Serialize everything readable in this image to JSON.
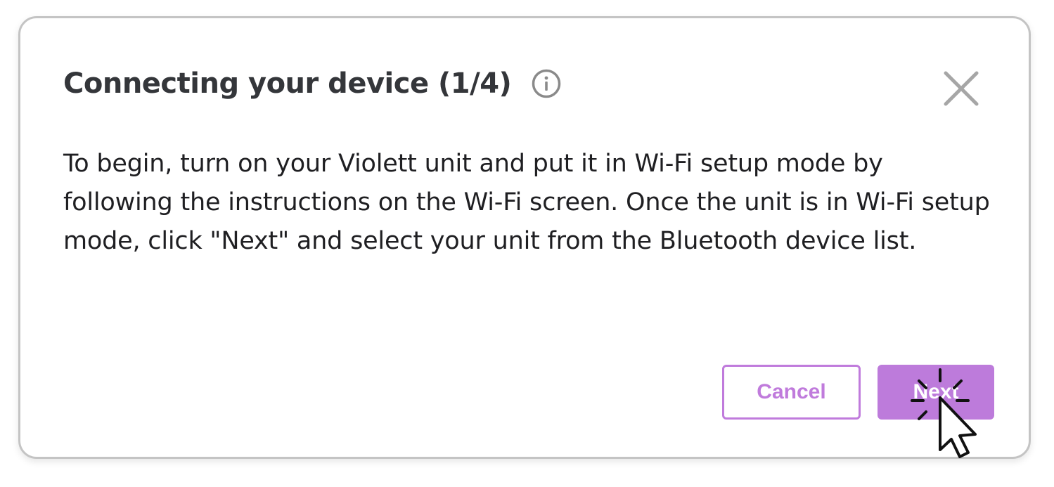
{
  "dialog": {
    "title": "Connecting your device (1/4)",
    "body": "To begin, turn on your Violett unit and put it in Wi-Fi setup mode by following the instructions on the Wi-Fi screen. Once the unit is in Wi-Fi setup mode, click \"Next\" and select your unit from the Bluetooth device list.",
    "info_icon": "info-circle-icon",
    "close_icon": "close-x-icon"
  },
  "actions": {
    "cancel_label": "Cancel",
    "next_label": "Next"
  },
  "colors": {
    "accent": "#bd7bdb",
    "title_text": "#34363a",
    "body_text": "#1f1f22",
    "border": "#c4c4c4",
    "icon_gray": "#8a8a8a"
  },
  "cursor": {
    "icon": "pointer-click-icon"
  }
}
